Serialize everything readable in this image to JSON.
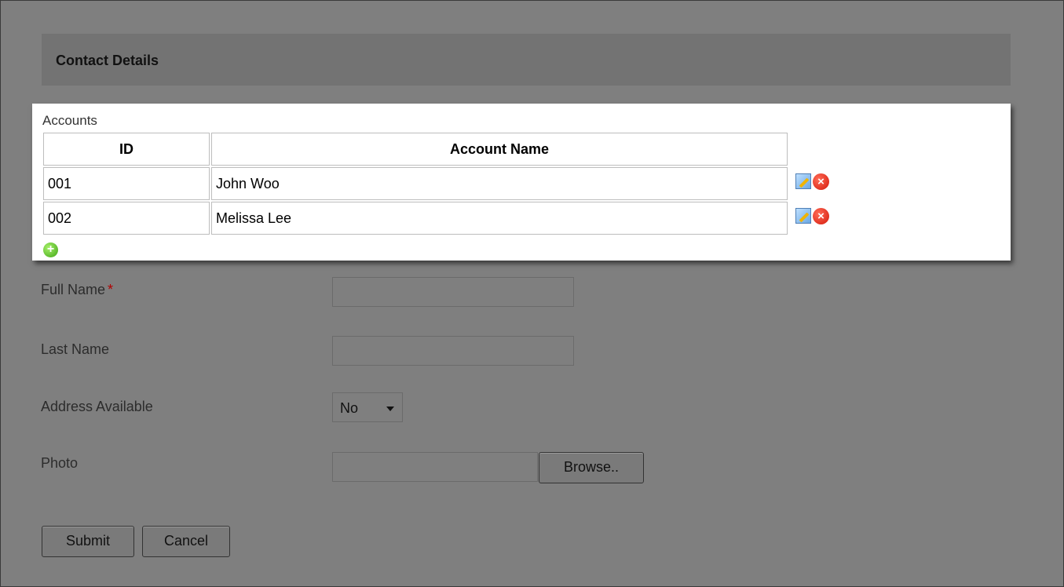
{
  "section": {
    "title": "Contact Details"
  },
  "accounts": {
    "caption": "Accounts",
    "headers": {
      "id": "ID",
      "name": "Account Name"
    },
    "rows": [
      {
        "id": "001",
        "name": "John Woo"
      },
      {
        "id": "002",
        "name": "Melissa Lee"
      }
    ],
    "icons": {
      "edit": "edit-icon",
      "delete": "delete-icon",
      "add": "add-icon"
    }
  },
  "form": {
    "full_name_label": "Full Name",
    "required_marker": "*",
    "last_name_label": "Last Name",
    "address_label": "Address Available",
    "address_value": "No",
    "photo_label": "Photo",
    "browse_label": "Browse..",
    "submit_label": "Submit",
    "cancel_label": "Cancel"
  }
}
